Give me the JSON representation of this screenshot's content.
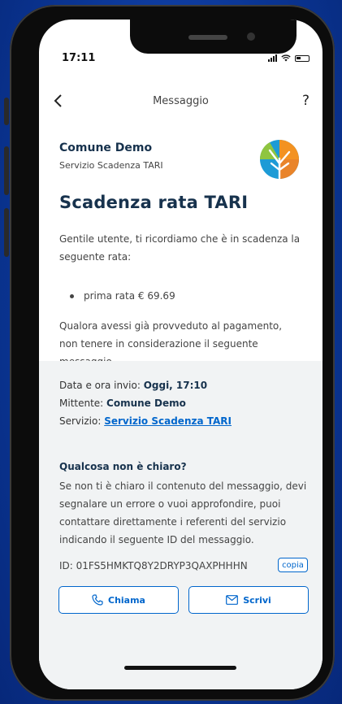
{
  "status_bar": {
    "time": "17:11"
  },
  "nav": {
    "back_symbol": "<",
    "title": "Messaggio",
    "help_symbol": "?"
  },
  "message": {
    "sender": "Comune Demo",
    "service": "Servizio Scadenza TARI",
    "title": "Scadenza rata TARI",
    "intro": "Gentile utente, ti ricordiamo che è in scadenza la seguente rata:",
    "bullet": "prima rata € 69.69",
    "outro": "Qualora avessi già provveduto al pagamento, non tenere in considerazione il seguente messaggio."
  },
  "details": {
    "date_label": "Data e ora invio: ",
    "date_value": "Oggi, 17:10",
    "sender_label": "Mittente: ",
    "sender_value": "Comune Demo",
    "service_label": "Servizio: ",
    "service_value": "Servizio Scadenza TARI",
    "question_title": "Qualcosa non è chiaro?",
    "question_text": "Se non ti è chiaro il contenuto del messaggio, devi segnalare un errore o vuoi approfondire, puoi contattare direttamente i referenti del servizio indicando il seguente ID del messaggio.",
    "id_text": "ID: 01FS5HMKTQ8Y2DRYP3QAXPHHHN",
    "copy_label": "copia",
    "call_label": "Chiama",
    "write_label": "Scrivi"
  },
  "icons": {
    "back": "chevron-left-icon",
    "help": "question-icon",
    "call": "phone-icon",
    "write": "envelope-icon",
    "logo": "comune-logo-icon"
  },
  "colors": {
    "background": "#0b3a9a",
    "heading": "#17324d",
    "link": "#0066cc",
    "details_bg": "#f1f3f4",
    "logo_blue": "#1d9bd6",
    "logo_orange": "#f39221",
    "logo_green": "#8fc540"
  }
}
